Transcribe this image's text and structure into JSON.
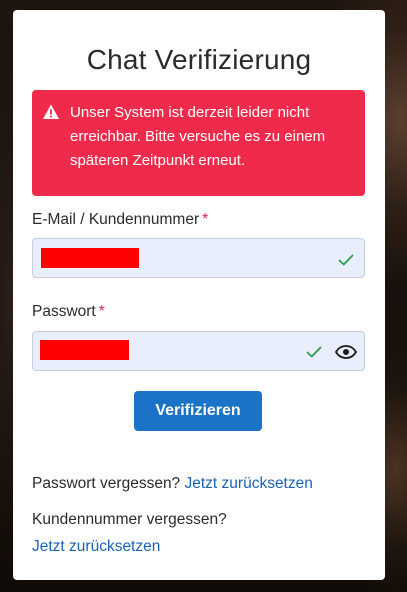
{
  "title": "Chat Verifizierung",
  "alert": {
    "icon": "warning-triangle-icon",
    "message": "Unser System ist derzeit leider nicht erreichbar. Bitte versuche es zu einem späteren Zeitpunkt erneut.",
    "color": "#f02a4b"
  },
  "email": {
    "label": "E-Mail / Kundennummer",
    "required_mark": "*",
    "value": "",
    "redacted": true,
    "valid": true
  },
  "password": {
    "label": "Passwort",
    "required_mark": "*",
    "value": "",
    "redacted": true,
    "valid": true,
    "toggle_icon": "eye-icon"
  },
  "submit_label": "Verifizieren",
  "forgot_password": {
    "text": "Passwort vergessen?",
    "link": "Jetzt zurücksetzen"
  },
  "forgot_customer_number": {
    "text": "Kundennummer vergessen?",
    "link": "Jetzt zurücksetzen"
  },
  "colors": {
    "accent": "#1a73c6",
    "link": "#1a62b6",
    "error": "#f02a4b",
    "valid_check": "#2e9b4f",
    "field_bg": "#e8eefb"
  }
}
